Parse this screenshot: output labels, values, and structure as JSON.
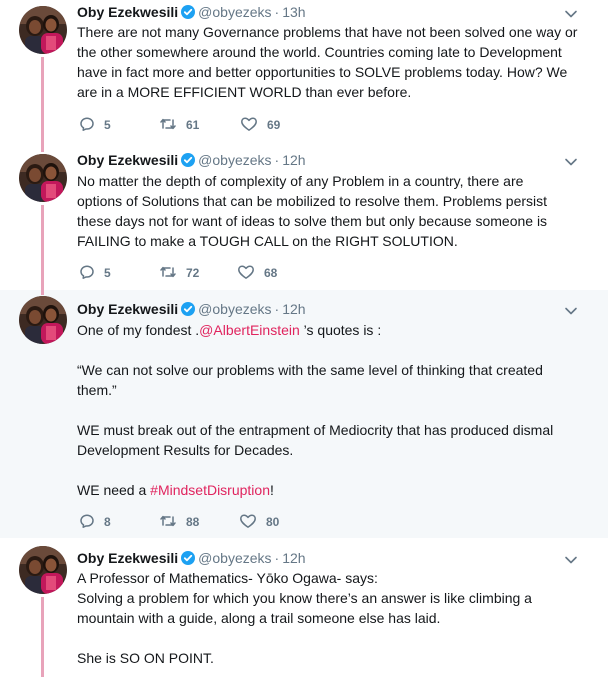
{
  "author": {
    "name": "Oby Ezekwesili",
    "handle": "@obyezeks",
    "dot": "·"
  },
  "tweets": [
    {
      "time": "13h",
      "lines": [
        "There are not many Governance problems that have not been solved one way or",
        "the other somewhere around the world. Countries coming late to Development",
        "have in fact more and better opportunities to SOLVE problems today. How? We",
        "are in a MORE EFFICIENT WORLD than ever before."
      ],
      "replies": "5",
      "retweets": "61",
      "likes": "69"
    },
    {
      "time": "12h",
      "lines": [
        "No matter the depth of complexity of any Problem in a country, there are",
        "options of Solutions that can be mobilized to resolve them. Problems persist",
        "these days not for want of ideas to solve them but only because someone is",
        "FAILING to make a TOUGH CALL on the RIGHT SOLUTION."
      ],
      "replies": "5",
      "retweets": "72",
      "likes": "68"
    },
    {
      "time": "12h",
      "intro_prefix": "One of my fondest .",
      "mention": "@AlbertEinstein",
      "intro_suffix": " ’s quotes is :",
      "quote_lines": [
        "“We can not solve our problems with the same level of thinking that created",
        "them.”"
      ],
      "must_lines": [
        "WE must break out of the entrapment of Mediocrity that has produced dismal",
        "Development Results for Decades."
      ],
      "need_prefix": "WE need a ",
      "hashtag": "#MindsetDisruption",
      "need_suffix": "!",
      "replies": "8",
      "retweets": "88",
      "likes": "80"
    },
    {
      "time": "12h",
      "lines": [
        "A Professor of Mathematics- Yōko Ogawa- says:",
        "Solving a problem for which you know there’s an answer is like climbing a",
        "mountain with a guide, along a trail someone else has laid."
      ],
      "closing": "She is SO ON POINT."
    }
  ],
  "colors": {
    "thread_line": "#e8a3ba",
    "link": "#e0245e",
    "verified": "#1da1f2",
    "secondary": "#657786",
    "highlight_bg": "#f5f8fa"
  },
  "icons": [
    "verified-badge-icon",
    "caret-down-icon",
    "reply-icon",
    "retweet-icon",
    "like-icon"
  ]
}
